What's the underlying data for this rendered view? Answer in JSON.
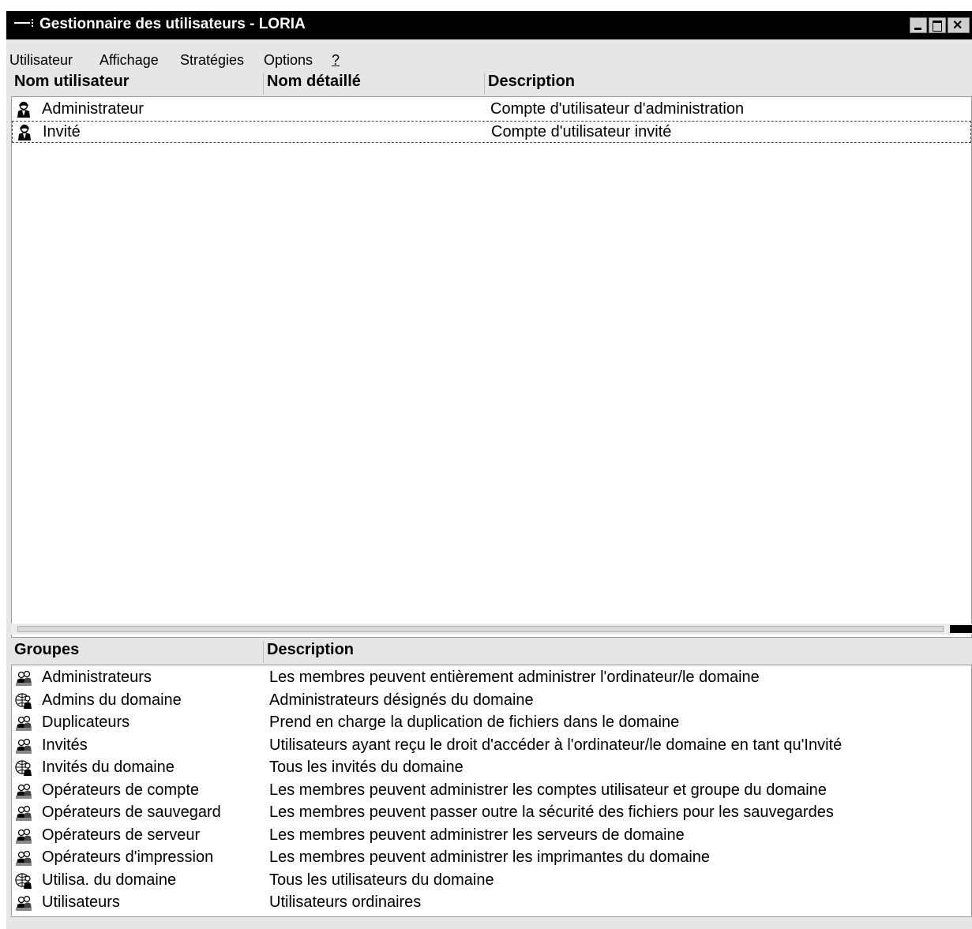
{
  "window": {
    "title": "Gestionnaire des utilisateurs - LORIA"
  },
  "menu": [
    "Utilisateur",
    "Affichage",
    "Stratégies",
    "Options",
    "?"
  ],
  "users": {
    "columns": [
      "Nom utilisateur",
      "Nom détaillé",
      "Description"
    ],
    "rows": [
      {
        "name": "Administrateur",
        "full_name": "",
        "description": "Compte d'utilisateur d'administration",
        "icon": "user-icon"
      },
      {
        "name": "Invité",
        "full_name": "",
        "description": "Compte d'utilisateur invité",
        "icon": "user-icon",
        "selected": true
      }
    ]
  },
  "groups": {
    "columns": [
      "Groupes",
      "Description"
    ],
    "rows": [
      {
        "name": "Administrateurs",
        "description": "Les membres peuvent entièrement administrer l'ordinateur/le domaine",
        "icon": "local-group-icon"
      },
      {
        "name": "Admins du domaine",
        "description": "Administrateurs désignés du domaine",
        "icon": "global-group-icon"
      },
      {
        "name": "Duplicateurs",
        "description": "Prend en charge la duplication de fichiers dans le domaine",
        "icon": "local-group-icon"
      },
      {
        "name": "Invités",
        "description": "Utilisateurs ayant reçu le droit d'accéder à l'ordinateur/le domaine en tant qu'Invité",
        "icon": "local-group-icon"
      },
      {
        "name": "Invités du domaine",
        "description": "Tous les invités du domaine",
        "icon": "global-group-icon"
      },
      {
        "name": "Opérateurs de compte",
        "description": "Les membres peuvent administrer les comptes utilisateur et groupe du domaine",
        "icon": "local-group-icon"
      },
      {
        "name": "Opérateurs de sauvegard",
        "description": "Les membres peuvent passer outre la sécurité des fichiers pour les sauvegardes",
        "icon": "local-group-icon"
      },
      {
        "name": "Opérateurs de serveur",
        "description": "Les membres peuvent administrer les serveurs de domaine",
        "icon": "local-group-icon"
      },
      {
        "name": "Opérateurs d'impression",
        "description": "Les membres peuvent administrer les imprimantes du domaine",
        "icon": "local-group-icon"
      },
      {
        "name": "Utilisa. du domaine",
        "description": "Tous les utilisateurs du domaine",
        "icon": "global-group-icon"
      },
      {
        "name": "Utilisateurs",
        "description": "Utilisateurs ordinaires",
        "icon": "local-group-icon"
      }
    ]
  }
}
